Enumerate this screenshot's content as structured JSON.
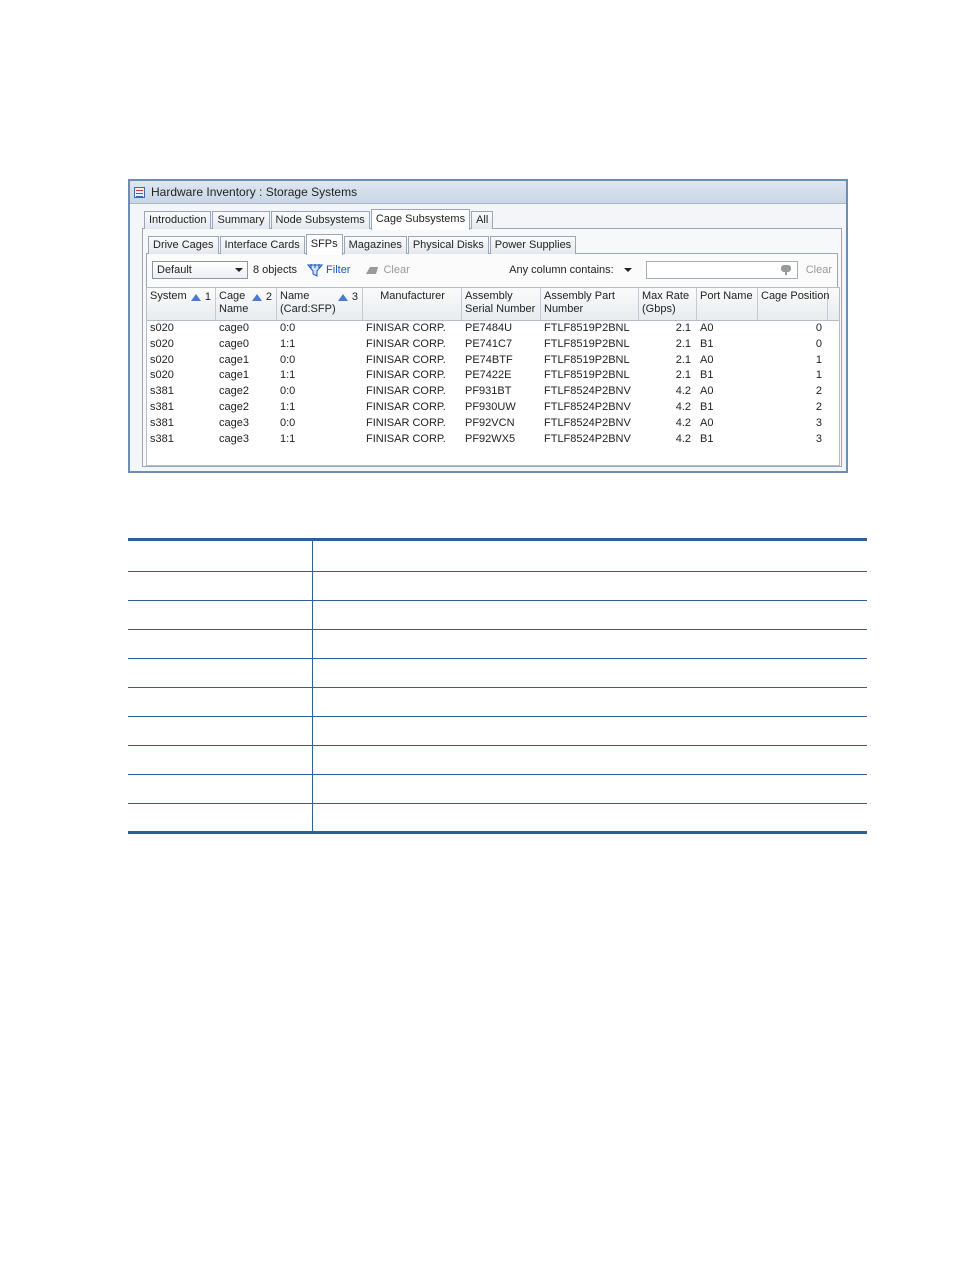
{
  "window": {
    "title": "Hardware Inventory : Storage Systems"
  },
  "outer_tabs": [
    {
      "label": "Introduction",
      "active": false
    },
    {
      "label": "Summary",
      "active": false
    },
    {
      "label": "Node Subsystems",
      "active": false
    },
    {
      "label": "Cage Subsystems",
      "active": true
    },
    {
      "label": "All",
      "active": false
    }
  ],
  "inner_tabs": [
    {
      "label": "Drive Cages",
      "active": false
    },
    {
      "label": "Interface Cards",
      "active": false
    },
    {
      "label": "SFPs",
      "active": true
    },
    {
      "label": "Magazines",
      "active": false
    },
    {
      "label": "Physical Disks",
      "active": false
    },
    {
      "label": "Power Supplies",
      "active": false
    }
  ],
  "toolbar": {
    "view_select": "Default",
    "object_count": "8 objects",
    "filter_label": "Filter",
    "clear_label": "Clear",
    "any_column_label": "Any column contains:",
    "search_value": "",
    "search_clear_label": "Clear"
  },
  "columns": [
    {
      "line1": "System",
      "line2": "",
      "sort": "1"
    },
    {
      "line1": "Cage",
      "line2": "Name",
      "sort": "2"
    },
    {
      "line1": "Name",
      "line2": "(Card:SFP)",
      "sort": "3"
    },
    {
      "line1": "Manufacturer",
      "line2": "",
      "sort": ""
    },
    {
      "line1": "Assembly",
      "line2": "Serial Number",
      "sort": ""
    },
    {
      "line1": "Assembly Part",
      "line2": "Number",
      "sort": ""
    },
    {
      "line1": "Max Rate",
      "line2": "(Gbps)",
      "sort": ""
    },
    {
      "line1": "Port Name",
      "line2": "",
      "sort": ""
    },
    {
      "line1": "Cage Position",
      "line2": "",
      "sort": ""
    }
  ],
  "rows": [
    [
      "s020",
      "cage0",
      "0:0",
      "FINISAR CORP.",
      "PE7484U",
      "FTLF8519P2BNL",
      "2.1",
      "A0",
      "0"
    ],
    [
      "s020",
      "cage0",
      "1:1",
      "FINISAR CORP.",
      "PE741C7",
      "FTLF8519P2BNL",
      "2.1",
      "B1",
      "0"
    ],
    [
      "s020",
      "cage1",
      "0:0",
      "FINISAR CORP.",
      "PE74BTF",
      "FTLF8519P2BNL",
      "2.1",
      "A0",
      "1"
    ],
    [
      "s020",
      "cage1",
      "1:1",
      "FINISAR CORP.",
      "PE7422E",
      "FTLF8519P2BNL",
      "2.1",
      "B1",
      "1"
    ],
    [
      "s381",
      "cage2",
      "0:0",
      "FINISAR CORP.",
      "PF931BT",
      "FTLF8524P2BNV",
      "4.2",
      "A0",
      "2"
    ],
    [
      "s381",
      "cage2",
      "1:1",
      "FINISAR CORP.",
      "PF930UW",
      "FTLF8524P2BNV",
      "4.2",
      "B1",
      "2"
    ],
    [
      "s381",
      "cage3",
      "0:0",
      "FINISAR CORP.",
      "PF92VCN",
      "FTLF8524P2BNV",
      "4.2",
      "A0",
      "3"
    ],
    [
      "s381",
      "cage3",
      "1:1",
      "FINISAR CORP.",
      "PF92WX5",
      "FTLF8524P2BNV",
      "4.2",
      "B1",
      "3"
    ]
  ],
  "colors": {
    "accent": "#1a55c4",
    "sort_icon": "#4a7cc9",
    "table_rule": "#2f5f94"
  },
  "icons": {
    "window": "inventory-list-icon",
    "filter": "filter-funnel-icon",
    "clear": "eraser-icon",
    "search": "microphone-search-icon"
  }
}
